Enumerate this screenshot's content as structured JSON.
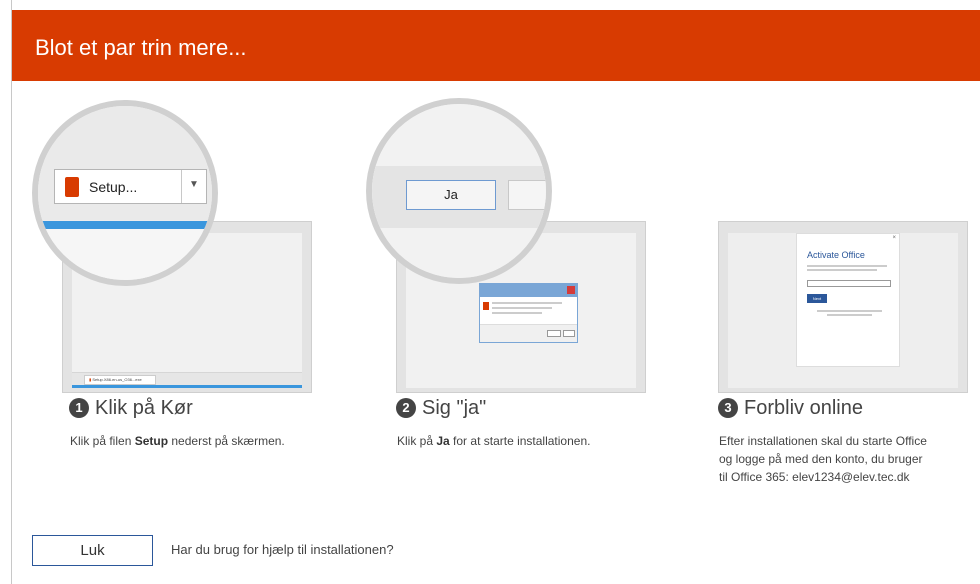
{
  "header": {
    "title": "Blot et par trin mere..."
  },
  "steps": [
    {
      "number": "1",
      "title": "Klik på Kør",
      "desc_prefix": "Klik på filen ",
      "desc_bold": "Setup",
      "desc_suffix": " nederst på skærmen.",
      "magnifier_button": "Setup...",
      "taskbar_file": "Setup.X86.en-us_O36...exe"
    },
    {
      "number": "2",
      "title": "Sig \"ja\"",
      "desc_prefix": "Klik på ",
      "desc_bold": "Ja",
      "desc_suffix": " for at starte installationen.",
      "magnifier_button": "Ja"
    },
    {
      "number": "3",
      "title": "Forbliv online",
      "desc_line1": "Efter installationen skal du starte Office",
      "desc_line2": "og logge på med den konto, du bruger",
      "desc_line3_prefix": "til Office 365: ",
      "desc_email": "elev1234@elev.tec.dk",
      "activate": {
        "title": "Activate Office",
        "button": "Next"
      }
    }
  ],
  "footer": {
    "close_label": "Luk",
    "help_text": "Har du brug for hjælp til installationen?"
  }
}
